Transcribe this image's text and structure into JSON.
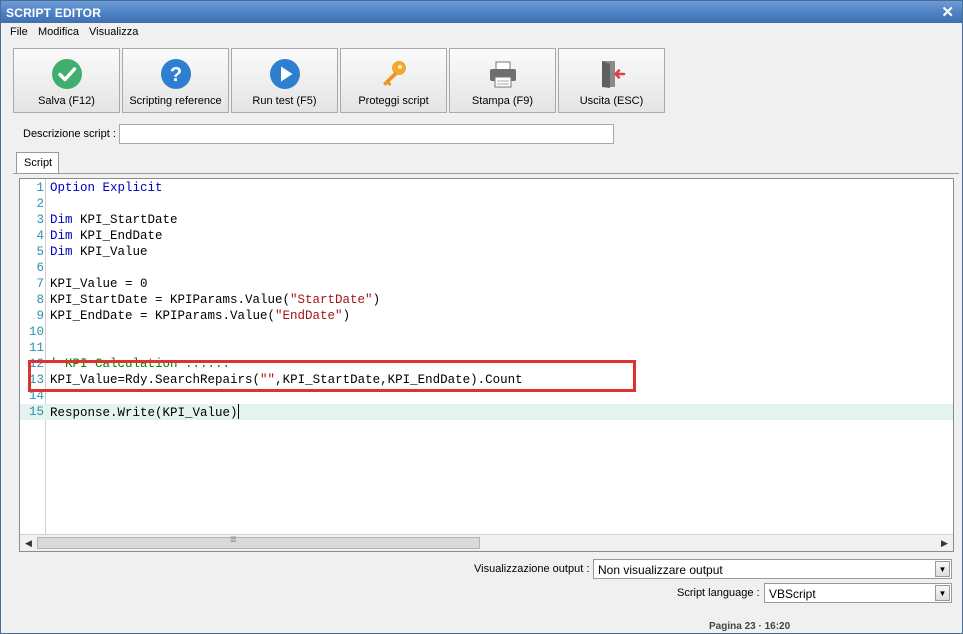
{
  "window": {
    "title": "SCRIPT EDITOR",
    "close_glyph": "✕"
  },
  "menu": [
    "File",
    "Modifica",
    "Visualizza"
  ],
  "toolbar": [
    {
      "label": "Salva (F12)",
      "icon": "check-circle-icon"
    },
    {
      "label": "Scripting reference",
      "icon": "help-circle-icon"
    },
    {
      "label": "Run test (F5)",
      "icon": "play-circle-icon"
    },
    {
      "label": "Proteggi script",
      "icon": "key-icon"
    },
    {
      "label": "Stampa (F9)",
      "icon": "printer-icon"
    },
    {
      "label": "Uscita (ESC)",
      "icon": "exit-door-icon"
    }
  ],
  "description": {
    "label": "Descrizione script :",
    "value": ""
  },
  "tabs": [
    "Script"
  ],
  "editor": {
    "lines": [
      {
        "n": "1",
        "tokens": [
          {
            "t": "Option Explicit",
            "c": "kw"
          }
        ]
      },
      {
        "n": "2",
        "tokens": []
      },
      {
        "n": "3",
        "tokens": [
          {
            "t": "Dim",
            "c": "kw"
          },
          {
            "t": " KPI_StartDate",
            "c": ""
          }
        ]
      },
      {
        "n": "4",
        "tokens": [
          {
            "t": "Dim",
            "c": "kw"
          },
          {
            "t": " KPI_EndDate",
            "c": ""
          }
        ]
      },
      {
        "n": "5",
        "tokens": [
          {
            "t": "Dim",
            "c": "kw"
          },
          {
            "t": " KPI_Value",
            "c": ""
          }
        ]
      },
      {
        "n": "6",
        "tokens": []
      },
      {
        "n": "7",
        "tokens": [
          {
            "t": "KPI_Value = 0",
            "c": ""
          }
        ]
      },
      {
        "n": "8",
        "tokens": [
          {
            "t": "KPI_StartDate = KPIParams.Value(",
            "c": ""
          },
          {
            "t": "\"StartDate\"",
            "c": "str"
          },
          {
            "t": ")",
            "c": ""
          }
        ]
      },
      {
        "n": "9",
        "tokens": [
          {
            "t": "KPI_EndDate = KPIParams.Value(",
            "c": ""
          },
          {
            "t": "\"EndDate\"",
            "c": "str"
          },
          {
            "t": ")",
            "c": ""
          }
        ]
      },
      {
        "n": "10",
        "tokens": []
      },
      {
        "n": "11",
        "tokens": []
      },
      {
        "n": "12",
        "tokens": [
          {
            "t": "' KPI Calculation ......",
            "c": "cmt"
          }
        ]
      },
      {
        "n": "13",
        "tokens": [
          {
            "t": "KPI_Value=Rdy.SearchRepairs(",
            "c": ""
          },
          {
            "t": "\"\"",
            "c": "str"
          },
          {
            "t": ",KPI_StartDate,KPI_EndDate).Count",
            "c": ""
          }
        ]
      },
      {
        "n": "14",
        "tokens": []
      },
      {
        "n": "15",
        "tokens": [
          {
            "t": "Response.Write(KPI_Value)",
            "c": ""
          }
        ],
        "current": true
      }
    ]
  },
  "output": {
    "label": "Visualizzazione output :",
    "value": "Non visualizzare output"
  },
  "language": {
    "label": "Script language :",
    "value": "VBScript"
  },
  "status_fragment": "Pagina 23 · 16:20",
  "colors": {
    "title_bar": "#4b7ec2",
    "keyword": "#0000c0",
    "string": "#a31515",
    "line_number": "#2b91af",
    "highlight_border": "#e03030",
    "current_line": "#e4f3ef"
  }
}
